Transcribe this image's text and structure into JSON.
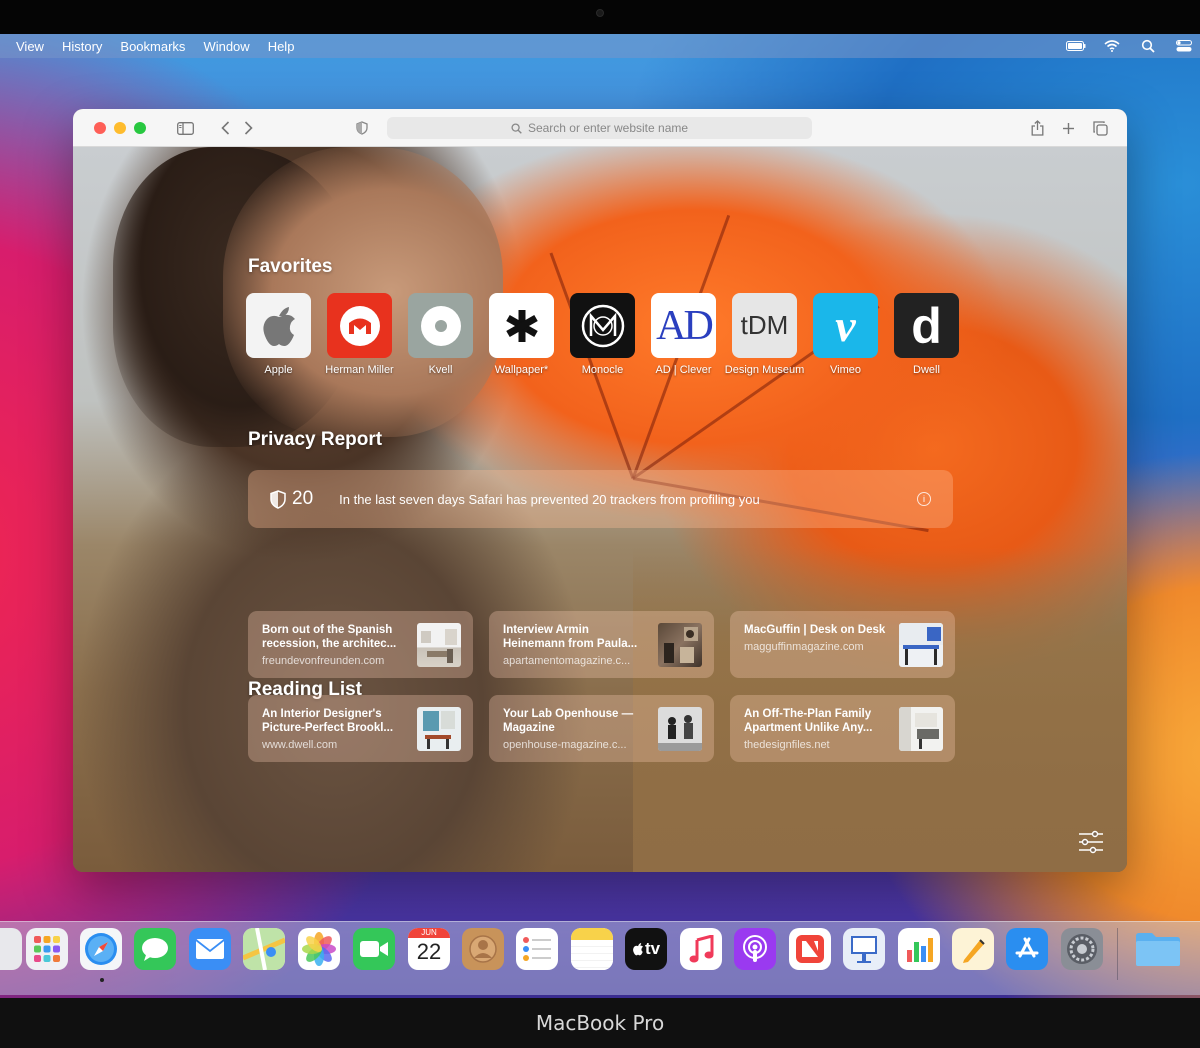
{
  "menubar": {
    "items": [
      "View",
      "History",
      "Bookmarks",
      "Window",
      "Help"
    ],
    "icons": [
      "battery-icon",
      "wifi-icon",
      "search-icon",
      "control-center-icon"
    ]
  },
  "safari": {
    "search_placeholder": "Search or enter website name",
    "favorites_title": "Favorites",
    "favorites": [
      {
        "label": "Apple",
        "color": "#f3f3f3"
      },
      {
        "label": "Herman Miller",
        "color": "#e8321e"
      },
      {
        "label": "Kvell",
        "color": "#9aa5a0"
      },
      {
        "label": "Wallpaper*",
        "color": "#ffffff"
      },
      {
        "label": "Monocle",
        "color": "#111111"
      },
      {
        "label": "AD | Clever",
        "color": "#ffffff"
      },
      {
        "label": "Design Museum",
        "color": "#e6e6e6"
      },
      {
        "label": "Vimeo",
        "color": "#1ab7ea"
      },
      {
        "label": "Dwell",
        "color": "#222222"
      }
    ],
    "favorite_glyphs": {
      "adclever": "AD",
      "designmuseum": "tDM",
      "vimeo": "v",
      "dwell": "d"
    },
    "privacy_title": "Privacy Report",
    "privacy_count": "20",
    "privacy_text": "In the last seven days Safari has prevented 20 trackers from profiling you",
    "reading_title": "Reading List",
    "reading": [
      {
        "title": "Born out of the Spanish recession, the architec...",
        "url": "freundevonfreunden.com"
      },
      {
        "title": "Interview Armin Heinemann from Paula...",
        "url": "apartamentomagazine.c..."
      },
      {
        "title": "MacGuffin | Desk on Desk",
        "url": "magguffinmagazine.com"
      },
      {
        "title": "An Interior Designer's Picture-Perfect Brookl...",
        "url": "www.dwell.com"
      },
      {
        "title": "Your Lab Openhouse — Magazine",
        "url": "openhouse-magazine.c..."
      },
      {
        "title": "An Off-The-Plan Family Apartment Unlike Any...",
        "url": "thedesignfiles.net"
      }
    ]
  },
  "dock": {
    "calendar_month": "JUN",
    "calendar_day": "22",
    "tv_label": "tv"
  },
  "device_label": "MacBook Pro"
}
